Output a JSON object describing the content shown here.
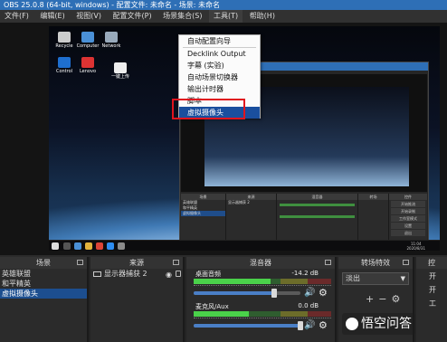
{
  "window": {
    "title": "OBS 25.0.8 (64-bit, windows) - 配置文件: 未命名 - 场景: 未命名"
  },
  "menu": [
    "文件(F)",
    "编辑(E)",
    "视图(V)",
    "配置文件(P)",
    "场景集合(S)",
    "工具(T)",
    "帮助(H)"
  ],
  "tools_menu": {
    "items": [
      "自动配置向导",
      "Decklink Output",
      "字幕 (实验)",
      "自动场景切换器",
      "输出计时器",
      "脚本",
      "虚拟摄像头"
    ],
    "highlighted": "虚拟摄像头"
  },
  "scenes": {
    "title": "场景",
    "items": [
      "英雄联盟",
      "和平精英",
      "虚拟摄像头"
    ],
    "selected": 2
  },
  "sources": {
    "title": "来源",
    "items": [
      "显示器捕获 2"
    ]
  },
  "mixer": {
    "title": "混音器",
    "channels": [
      {
        "name": "桌面音频",
        "db": "-14.2 dB",
        "level": 0.56,
        "volume": 0.75
      },
      {
        "name": "麦克风/Aux",
        "db": "0.0 dB",
        "level": 0.4,
        "volume": 1.0
      }
    ]
  },
  "transitions": {
    "title": "转场特效",
    "current": "淡出"
  },
  "controls": {
    "title": "控",
    "buttons": [
      "开",
      "开",
      "工"
    ]
  },
  "watermark": "悟空问答",
  "nested": {
    "title": "OBS 25.0.8 - 配置文件: 未命名",
    "scenes_head": "场景",
    "sources_head": "来源",
    "mixer_head": "混音器",
    "trans_head": "转场",
    "controls_head": "控件",
    "scene_items": [
      "英雄联盟",
      "和平精英",
      "虚拟摄像头"
    ],
    "source_items": [
      "显示器捕获 2"
    ],
    "control_buttons": [
      "开始推流",
      "开始录制",
      "工作室模式",
      "设置",
      "退出"
    ]
  },
  "taskbar": {
    "time": "11:04",
    "date": "2020/8/31"
  },
  "desktop_icons": [
    "Recycle",
    "Computer",
    "Network",
    "Control",
    "Lenovo",
    "一键上传"
  ],
  "colors": {
    "accent": "#2e6fb6",
    "highlight": "#1a4f9e",
    "annotation": "#e0141e"
  }
}
